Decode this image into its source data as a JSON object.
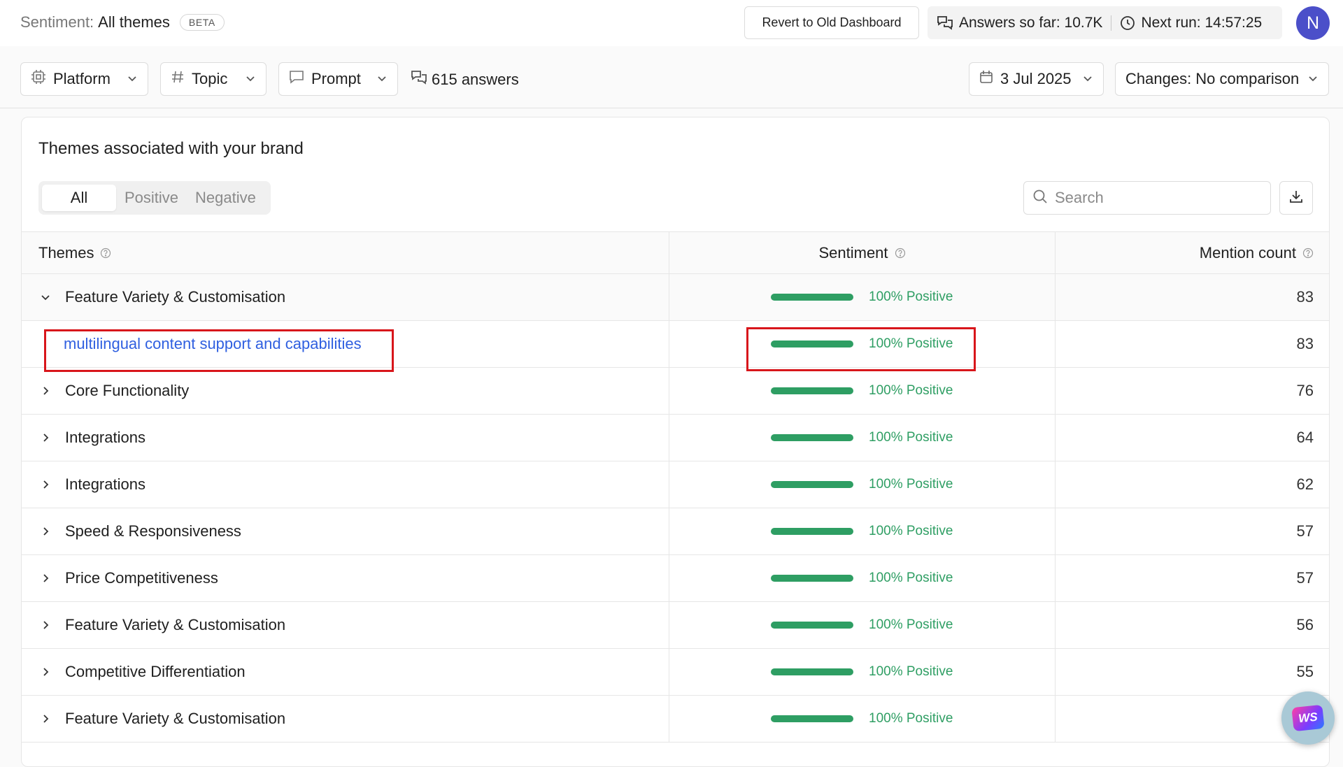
{
  "header": {
    "title_label": "Sentiment:",
    "title_value": "All themes",
    "badge": "BETA",
    "revert_button": "Revert to Old Dashboard",
    "answers_so_far": "Answers so far: 10.7K",
    "next_run": "Next run: 14:57:25",
    "avatar_initial": "N"
  },
  "filters": {
    "platform": "Platform",
    "topic": "Topic",
    "prompt": "Prompt",
    "answers_count": "615 answers",
    "date": "3 Jul 2025",
    "changes": "Changes: No comparison"
  },
  "card": {
    "title": "Themes associated with your brand",
    "segments": [
      "All",
      "Positive",
      "Negative"
    ],
    "active_segment": "All",
    "search_placeholder": "Search"
  },
  "table": {
    "columns": [
      "Themes",
      "Sentiment",
      "Mention count"
    ],
    "rows": [
      {
        "theme": "Feature Variety & Customisation",
        "sentiment": "100% Positive",
        "sentiment_fraction": 1.0,
        "count": "83",
        "expanded": true
      },
      {
        "theme": "multilingual content support and capabilities",
        "sentiment": "100% Positive",
        "sentiment_fraction": 1.0,
        "count": "83",
        "child": true
      },
      {
        "theme": "Core Functionality",
        "sentiment": "100% Positive",
        "sentiment_fraction": 1.0,
        "count": "76"
      },
      {
        "theme": "Integrations",
        "sentiment": "100% Positive",
        "sentiment_fraction": 1.0,
        "count": "64"
      },
      {
        "theme": "Integrations",
        "sentiment": "100% Positive",
        "sentiment_fraction": 1.0,
        "count": "62"
      },
      {
        "theme": "Speed & Responsiveness",
        "sentiment": "100% Positive",
        "sentiment_fraction": 1.0,
        "count": "57"
      },
      {
        "theme": "Price Competitiveness",
        "sentiment": "100% Positive",
        "sentiment_fraction": 1.0,
        "count": "57"
      },
      {
        "theme": "Feature Variety & Customisation",
        "sentiment": "100% Positive",
        "sentiment_fraction": 1.0,
        "count": "56"
      },
      {
        "theme": "Competitive Differentiation",
        "sentiment": "100% Positive",
        "sentiment_fraction": 1.0,
        "count": "55"
      },
      {
        "theme": "Feature Variety & Customisation",
        "sentiment": "100% Positive",
        "sentiment_fraction": 1.0,
        "count": ""
      }
    ]
  },
  "widget": {
    "label": "WS"
  },
  "colors": {
    "positive": "#2e9e63",
    "link": "#2f5fe0",
    "avatar": "#4b4fc9",
    "highlight": "#d8161b"
  }
}
